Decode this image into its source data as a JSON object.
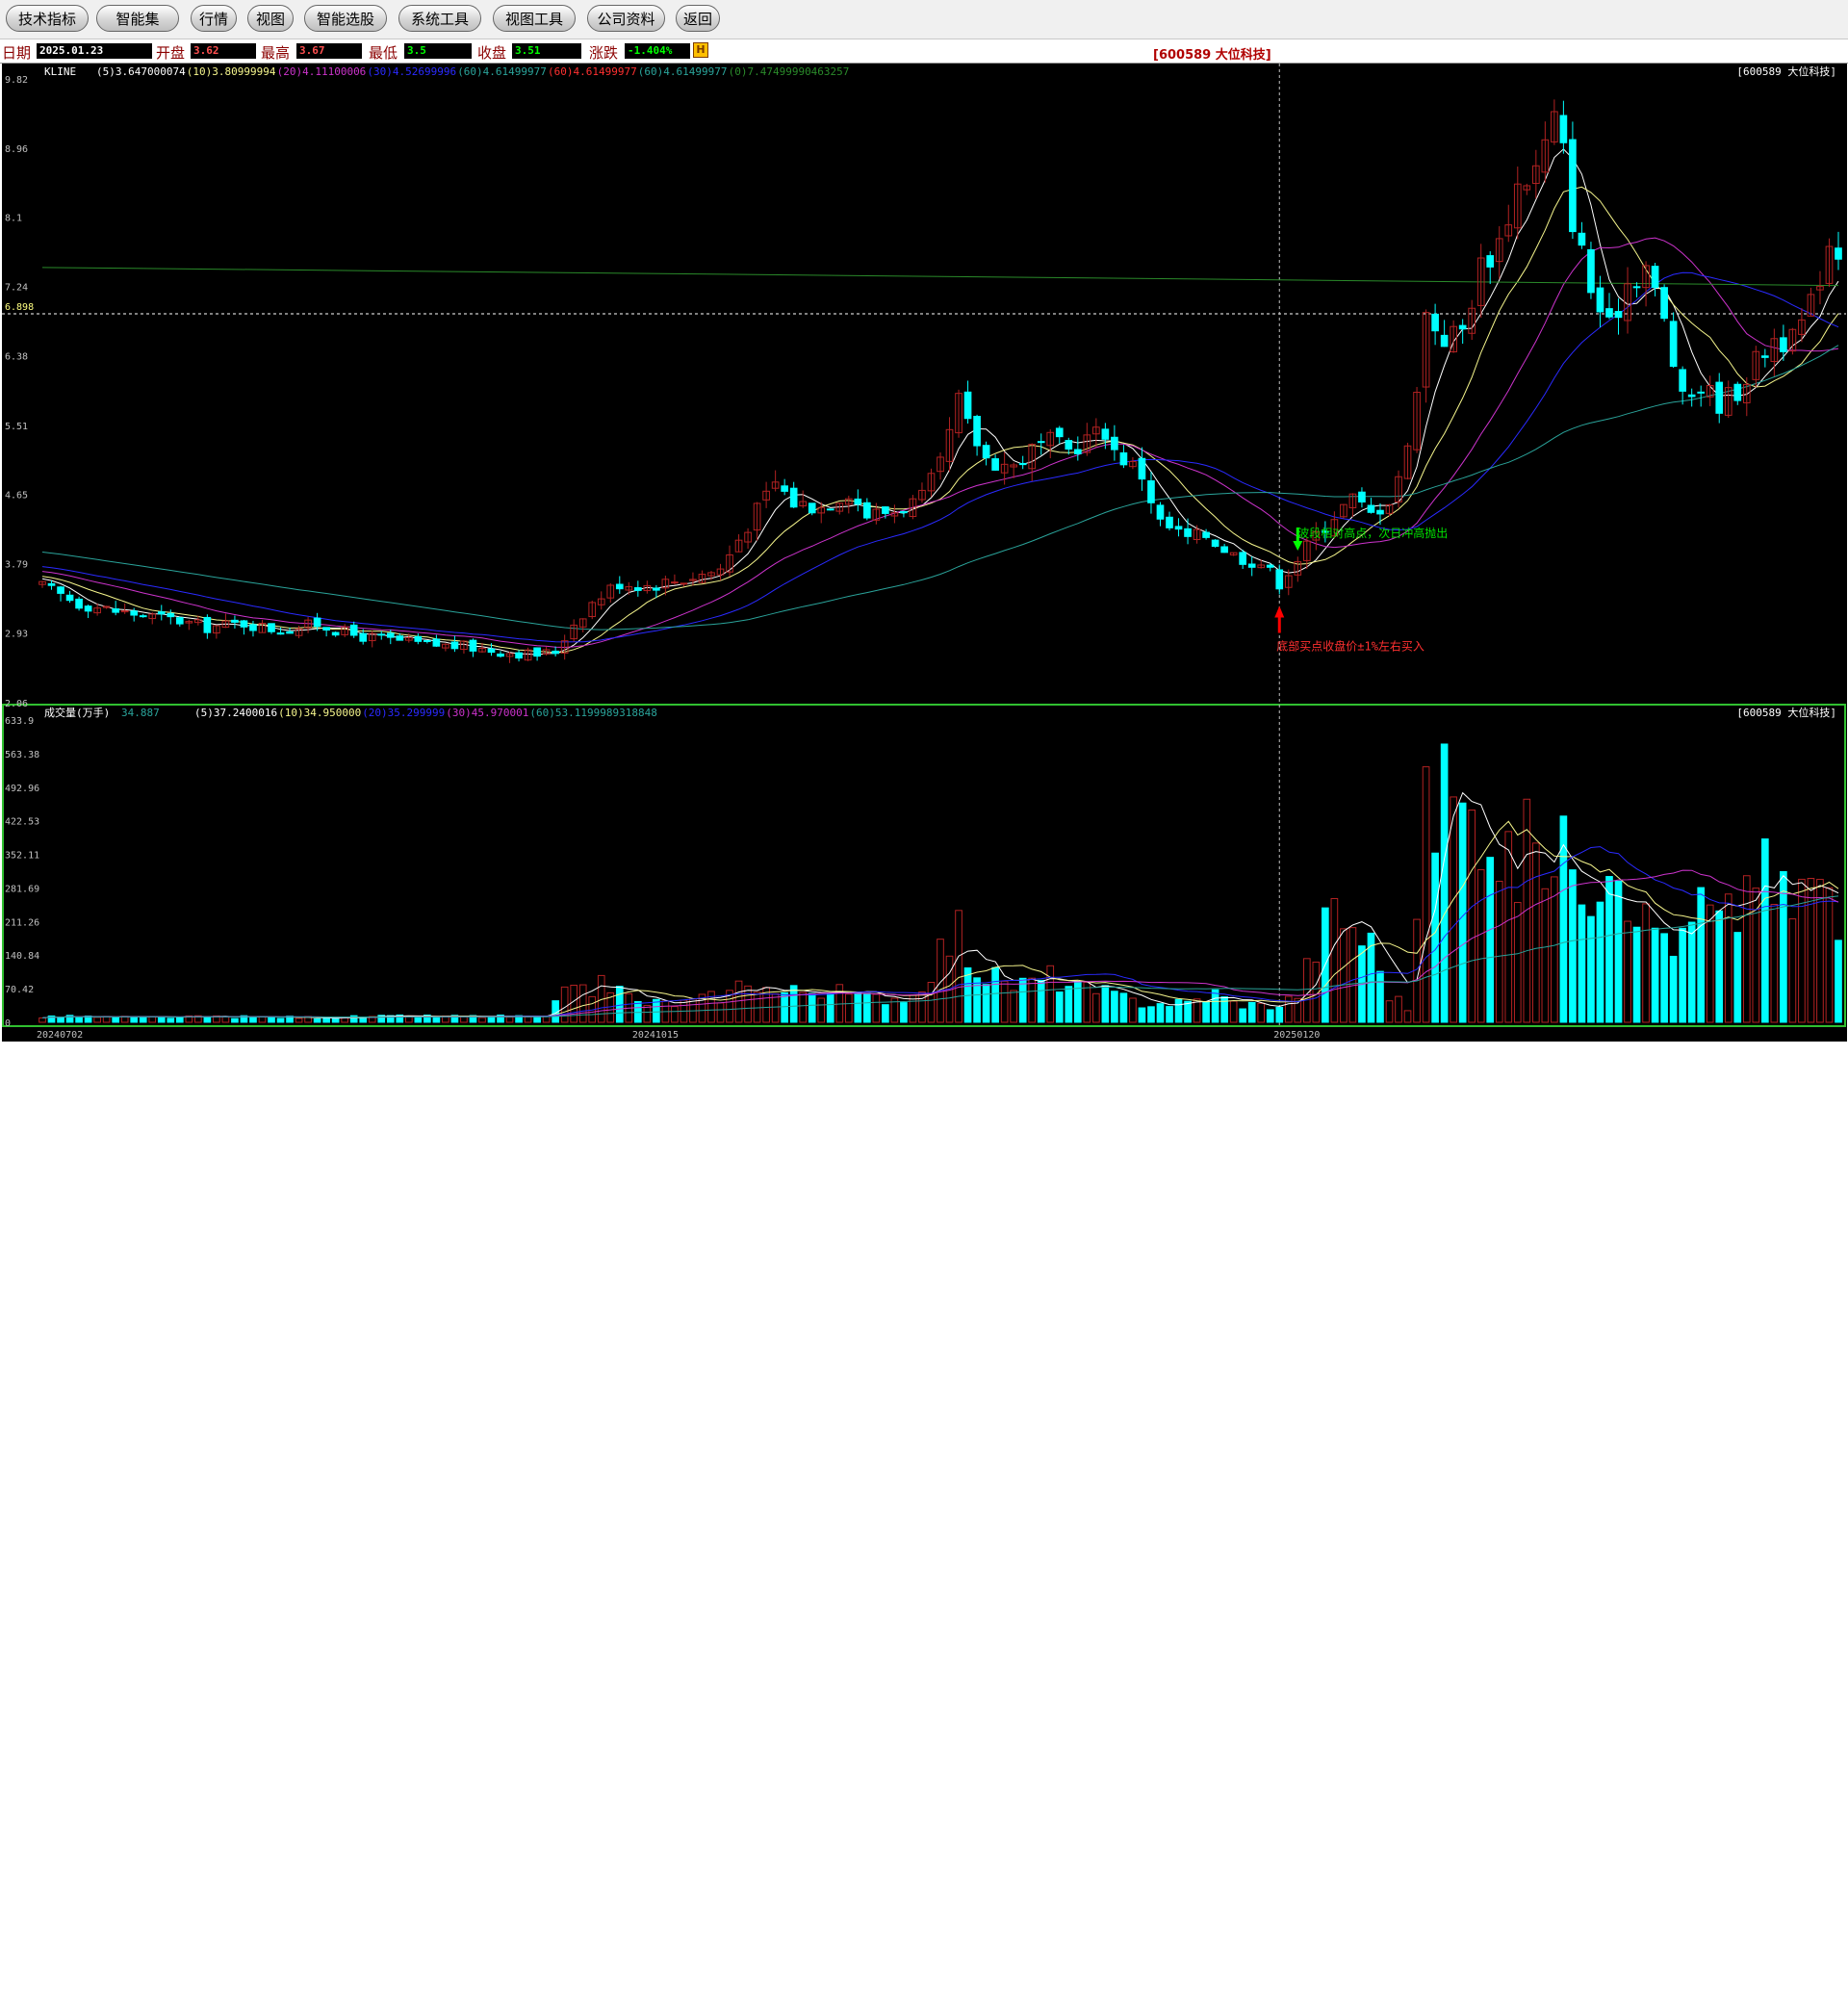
{
  "toolbar": {
    "buttons": [
      "技术指标",
      "智能集",
      "行情",
      "视图",
      "智能选股",
      "系统工具",
      "视图工具",
      "公司资料",
      "返回"
    ]
  },
  "infobar": {
    "date_label": "日期",
    "date_value": "2025.01.23",
    "open_label": "开盘",
    "open_value": "3.62",
    "high_label": "最高",
    "high_value": "3.67",
    "low_label": "最低",
    "low_value": "3.5",
    "close_label": "收盘",
    "close_value": "3.51",
    "change_label": "涨跌",
    "change_value": "-1.404%",
    "flag_icon": "H",
    "stock_title": "[600589 大位科技]"
  },
  "colors": {
    "up": "#b22222",
    "down": "#00ffff",
    "ma5": "#ffffff",
    "ma10": "#f5f58c",
    "ma20": "#cc33cc",
    "ma30": "#2a2aff",
    "ma60": "#2aa39a",
    "ma_long": "#2a8a2a"
  },
  "chart_data": [
    {
      "type": "candlestick",
      "title": "KLINE",
      "stock_label": "[600589 大位科技]",
      "legend": [
        {
          "key": "(5)",
          "value": "3.647000074",
          "color": "#ffffff"
        },
        {
          "key": "(10)",
          "value": "3.80999994",
          "color": "#f5f58c"
        },
        {
          "key": "(20)",
          "value": "4.11100006",
          "color": "#cc33cc"
        },
        {
          "key": "(30)",
          "value": "4.52699996",
          "color": "#2a2aff"
        },
        {
          "key": "(60)",
          "value": "4.61499977",
          "color": "#2aa39a"
        },
        {
          "key": "(60)",
          "value": "4.61499977",
          "color": "#ff3030"
        },
        {
          "key": "(60)",
          "value": "4.61499977",
          "color": "#2aa39a"
        },
        {
          "key": "(0)",
          "value": "7.47499990463257",
          "color": "#2a8a2a"
        }
      ],
      "y_ticks": [
        "9.82",
        "8.96",
        "8.1",
        "7.24",
        "6.38",
        "5.51",
        "4.65",
        "3.79",
        "2.93",
        "2.06"
      ],
      "ylim": [
        2.06,
        9.82
      ],
      "crosshair_price": "6.898",
      "long_line": [
        7.475,
        7.25
      ],
      "annotations": [
        {
          "text": "波段相对高点，次日冲高抛出",
          "color": "#00e000",
          "x_index": 137,
          "price": 4.0
        },
        {
          "text": "底部买点收盘价±1%左右买入",
          "color": "#ff3030",
          "x_index": 135,
          "price": 3.0
        }
      ],
      "arrows": [
        {
          "kind": "sell",
          "color": "#00ff00",
          "x_index": 137
        },
        {
          "kind": "buy",
          "color": "#ff0000",
          "x_index": 135
        }
      ],
      "crosshair_index": 135,
      "ohlc_anchors": [
        [
          0,
          3.5
        ],
        [
          4,
          3.3
        ],
        [
          8,
          3.2
        ],
        [
          14,
          3.1
        ],
        [
          18,
          3.0
        ],
        [
          22,
          3.05
        ],
        [
          26,
          2.96
        ],
        [
          30,
          3.04
        ],
        [
          34,
          2.9
        ],
        [
          38,
          2.84
        ],
        [
          42,
          2.78
        ],
        [
          46,
          2.76
        ],
        [
          50,
          2.7
        ],
        [
          54,
          2.66
        ],
        [
          56,
          2.7
        ],
        [
          58,
          3.05
        ],
        [
          60,
          3.3
        ],
        [
          62,
          3.48
        ],
        [
          63,
          3.55
        ],
        [
          66,
          3.52
        ],
        [
          70,
          3.6
        ],
        [
          74,
          3.72
        ],
        [
          76,
          4.1
        ],
        [
          78,
          4.45
        ],
        [
          80,
          4.8
        ],
        [
          82,
          4.55
        ],
        [
          85,
          4.5
        ],
        [
          88,
          4.7
        ],
        [
          90,
          4.4
        ],
        [
          93,
          4.45
        ],
        [
          96,
          4.6
        ],
        [
          98,
          5.0
        ],
        [
          100,
          5.8
        ],
        [
          101,
          5.5
        ],
        [
          103,
          5.1
        ],
        [
          106,
          5.0
        ],
        [
          108,
          5.2
        ],
        [
          110,
          5.3
        ],
        [
          112,
          5.2
        ],
        [
          114,
          5.35
        ],
        [
          116,
          5.45
        ],
        [
          117,
          5.2
        ],
        [
          120,
          4.9
        ],
        [
          122,
          4.3
        ],
        [
          125,
          4.1
        ],
        [
          127,
          4.15
        ],
        [
          130,
          3.9
        ],
        [
          133,
          3.8
        ],
        [
          135,
          3.56
        ],
        [
          137,
          3.85
        ],
        [
          139,
          4.15
        ],
        [
          141,
          4.4
        ],
        [
          143,
          4.6
        ],
        [
          145,
          4.4
        ],
        [
          147,
          4.6
        ],
        [
          149,
          5.2
        ],
        [
          151,
          6.9
        ],
        [
          153,
          6.6
        ],
        [
          155,
          6.7
        ],
        [
          157,
          7.5
        ],
        [
          159,
          7.8
        ],
        [
          161,
          8.5
        ],
        [
          163,
          8.7
        ],
        [
          165,
          9.3
        ],
        [
          166,
          8.9
        ],
        [
          167,
          8.1
        ],
        [
          169,
          7.2
        ],
        [
          171,
          6.7
        ],
        [
          173,
          7.3
        ],
        [
          175,
          7.5
        ],
        [
          177,
          6.8
        ],
        [
          179,
          5.8
        ],
        [
          181,
          6.0
        ],
        [
          183,
          5.8
        ],
        [
          185,
          5.95
        ],
        [
          187,
          6.3
        ],
        [
          189,
          6.6
        ],
        [
          191,
          6.55
        ],
        [
          193,
          7.0
        ],
        [
          195,
          7.8
        ],
        [
          196,
          7.7
        ]
      ],
      "x_ticks": [
        {
          "label": "20240702",
          "index": 0
        },
        {
          "label": "20241015",
          "index": 65
        },
        {
          "label": "20250120",
          "index": 135
        }
      ],
      "bar_count": 197
    },
    {
      "type": "bar",
      "title": "成交量(万手)",
      "title_value": "34.887",
      "stock_label": "[600589 大位科技]",
      "legend": [
        {
          "key": "(5)",
          "value": "37.2400016",
          "color": "#ffffff"
        },
        {
          "key": "(10)",
          "value": "34.950000",
          "color": "#f5f58c"
        },
        {
          "key": "(20)",
          "value": "35.299999",
          "color": "#2a2aff"
        },
        {
          "key": "(30)",
          "value": "45.970001",
          "color": "#cc33cc"
        },
        {
          "key": "(60)",
          "value": "53.1199989318848",
          "color": "#2aa39a"
        }
      ],
      "y_ticks": [
        "633.9",
        "563.38",
        "492.96",
        "422.53",
        "352.11",
        "281.69",
        "211.26",
        "140.84",
        "70.42",
        "0"
      ],
      "ylim": [
        0,
        633.9
      ],
      "volume_anchors": [
        [
          0,
          12
        ],
        [
          10,
          10
        ],
        [
          20,
          11
        ],
        [
          30,
          10
        ],
        [
          40,
          12
        ],
        [
          50,
          12
        ],
        [
          55,
          10
        ],
        [
          57,
          60
        ],
        [
          58,
          95
        ],
        [
          59,
          70
        ],
        [
          62,
          80
        ],
        [
          65,
          40
        ],
        [
          70,
          40
        ],
        [
          75,
          60
        ],
        [
          77,
          95
        ],
        [
          80,
          60
        ],
        [
          85,
          70
        ],
        [
          90,
          50
        ],
        [
          95,
          55
        ],
        [
          98,
          150
        ],
        [
          100,
          190
        ],
        [
          102,
          110
        ],
        [
          105,
          80
        ],
        [
          108,
          80
        ],
        [
          110,
          95
        ],
        [
          113,
          70
        ],
        [
          116,
          60
        ],
        [
          120,
          40
        ],
        [
          125,
          40
        ],
        [
          128,
          60
        ],
        [
          130,
          40
        ],
        [
          133,
          35
        ],
        [
          135,
          35
        ],
        [
          137,
          60
        ],
        [
          139,
          160
        ],
        [
          141,
          230
        ],
        [
          143,
          200
        ],
        [
          145,
          160
        ],
        [
          147,
          60
        ],
        [
          149,
          30
        ],
        [
          151,
          420
        ],
        [
          153,
          500
        ],
        [
          155,
          420
        ],
        [
          157,
          450
        ],
        [
          159,
          380
        ],
        [
          161,
          300
        ],
        [
          163,
          430
        ],
        [
          165,
          310
        ],
        [
          167,
          380
        ],
        [
          169,
          290
        ],
        [
          171,
          390
        ],
        [
          173,
          300
        ],
        [
          175,
          210
        ],
        [
          177,
          190
        ],
        [
          179,
          160
        ],
        [
          181,
          250
        ],
        [
          183,
          200
        ],
        [
          185,
          230
        ],
        [
          187,
          350
        ],
        [
          189,
          260
        ],
        [
          191,
          250
        ],
        [
          193,
          300
        ],
        [
          195,
          250
        ],
        [
          196,
          180
        ]
      ]
    }
  ]
}
